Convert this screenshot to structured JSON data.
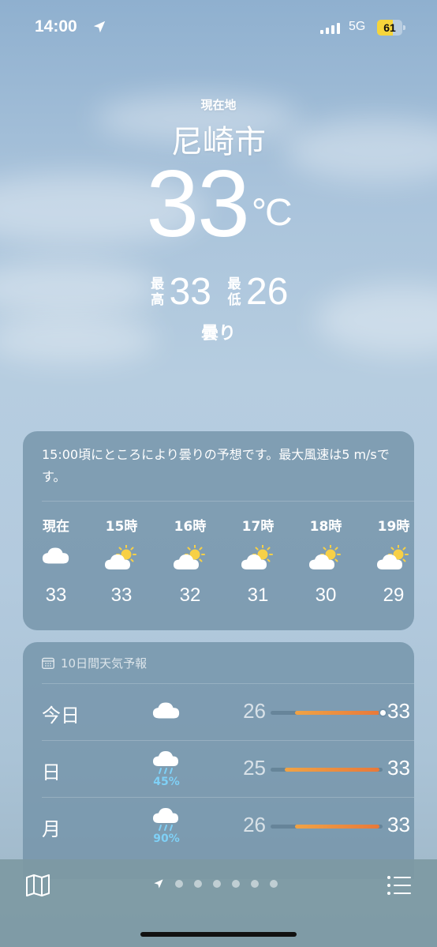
{
  "status_bar": {
    "time": "14:00",
    "network": "5G",
    "battery": "61",
    "battery_level": 0.61
  },
  "header": {
    "location_label": "現在地",
    "city": "尼崎市",
    "temperature": "33",
    "unit": "°C",
    "high_label": "最高",
    "high": "33",
    "low_label": "最低",
    "low": "26",
    "condition": "曇り"
  },
  "hourly": {
    "summary": "15:00頃にところにより曇りの予想です。最大風速は5 m/sです。",
    "hours": [
      {
        "label": "現在",
        "icon": "cloud-icon",
        "temp": "33"
      },
      {
        "label": "15時",
        "icon": "partly-sunny-icon",
        "temp": "33"
      },
      {
        "label": "16時",
        "icon": "partly-sunny-icon",
        "temp": "32"
      },
      {
        "label": "17時",
        "icon": "partly-sunny-icon",
        "temp": "31"
      },
      {
        "label": "18時",
        "icon": "partly-sunny-icon",
        "temp": "30"
      },
      {
        "label": "19時",
        "icon": "partly-sunny-icon",
        "temp": "29"
      }
    ]
  },
  "daily": {
    "title": "10日間天気予報",
    "days": [
      {
        "day": "今日",
        "icon": "cloud-icon",
        "pop": "",
        "low": "26",
        "high": "33"
      },
      {
        "day": "日",
        "icon": "rain-icon",
        "pop": "45%",
        "low": "25",
        "high": "33"
      },
      {
        "day": "月",
        "icon": "rain-icon",
        "pop": "90%",
        "low": "26",
        "high": "33"
      }
    ]
  },
  "toolbar": {
    "pages": 6,
    "left_icon": "map-icon",
    "right_icon": "list-icon"
  }
}
